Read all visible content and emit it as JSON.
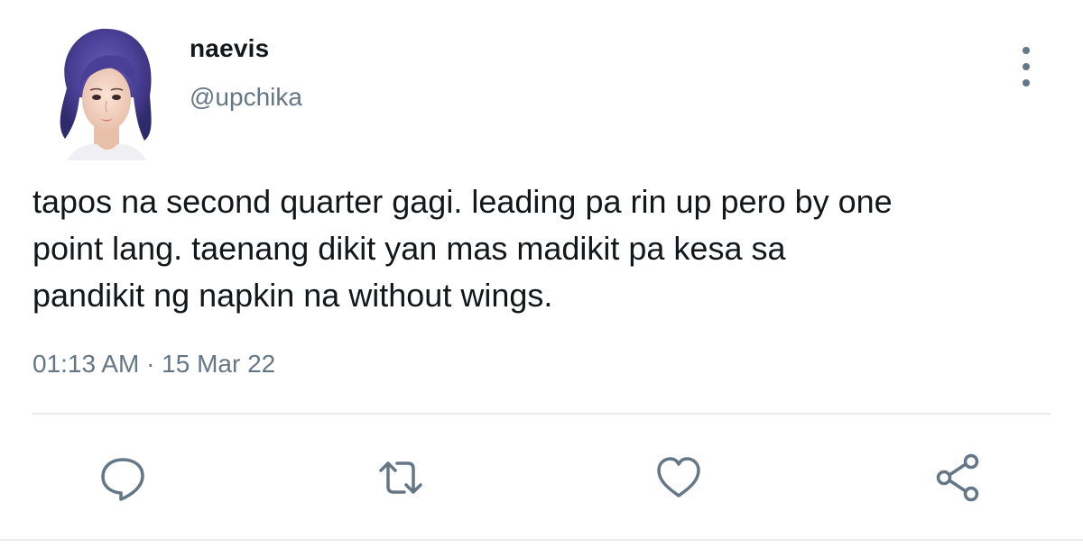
{
  "user": {
    "display_name": "naevis",
    "handle": "@upchika"
  },
  "tweet": {
    "text": "tapos na second quarter gagi. leading pa rin up pero by one\npoint lang. taenang dikit yan mas madikit pa kesa sa\npandikit ng napkin na without wings.",
    "timestamp": "01:13 AM · 15 Mar 22"
  },
  "icons": {
    "more": "more-vertical-icon",
    "reply": "speech-bubble-icon",
    "retweet": "retweet-arrows-icon",
    "like": "heart-icon",
    "share": "share-nodes-icon"
  },
  "colors": {
    "text": "#14171a",
    "secondary": "#657786",
    "divider": "#e6ecf0"
  }
}
